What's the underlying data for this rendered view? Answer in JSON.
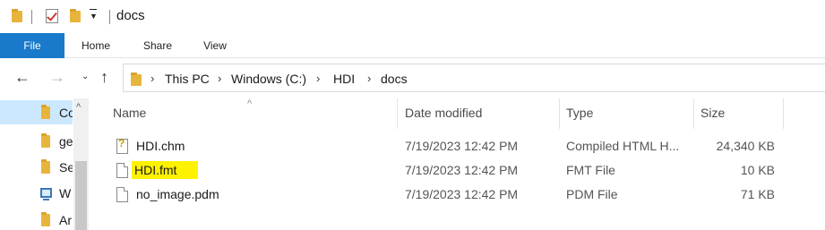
{
  "window": {
    "title": "docs"
  },
  "ribbon": {
    "tabs": [
      "File",
      "Home",
      "Share",
      "View"
    ],
    "active_color": "#1979ca"
  },
  "address": {
    "crumbs": [
      "This PC",
      "Windows (C:)",
      "HDI",
      "docs"
    ]
  },
  "sidebar": {
    "items": [
      {
        "label": "Co",
        "icon": "folder-icon",
        "selected": true
      },
      {
        "label": "ge",
        "icon": "folder-icon"
      },
      {
        "label": "Se",
        "icon": "folder-icon"
      },
      {
        "label": "W",
        "icon": "computer-icon"
      },
      {
        "label": "Ar",
        "icon": "folder-icon"
      }
    ]
  },
  "columns": {
    "name": "Name",
    "date": "Date modified",
    "type": "Type",
    "size": "Size"
  },
  "files": [
    {
      "name": "HDI.chm",
      "date": "7/19/2023 12:42 PM",
      "type": "Compiled HTML H...",
      "size": "24,340 KB",
      "icon": "chm-file-icon"
    },
    {
      "name": "HDI.fmt",
      "date": "7/19/2023 12:42 PM",
      "type": "FMT File",
      "size": "10 KB",
      "icon": "generic-file-icon",
      "highlighted": true
    },
    {
      "name": "no_image.pdm",
      "date": "7/19/2023 12:42 PM",
      "type": "PDM File",
      "size": "71 KB",
      "icon": "generic-file-icon"
    }
  ],
  "colors": {
    "highlight": "#fff200",
    "selection": "#cce8ff"
  }
}
